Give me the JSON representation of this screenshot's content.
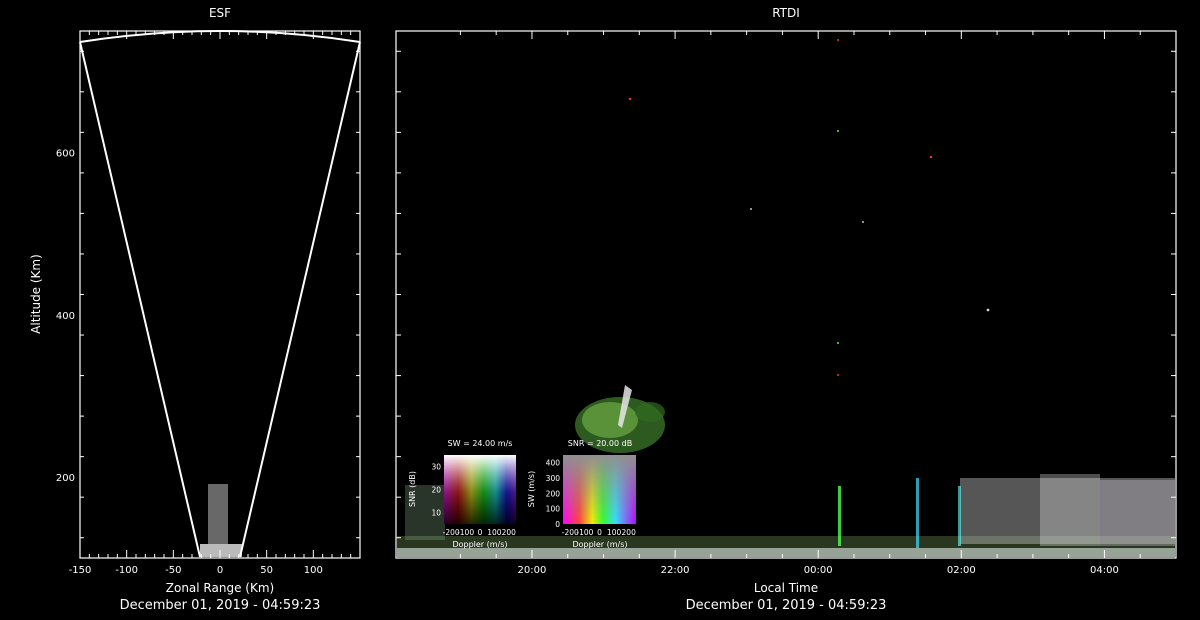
{
  "chart_data": [
    {
      "type": "heatmap",
      "title": "ESF",
      "xlabel": "Zonal Range (Km)",
      "ylabel": "Altitude (Km)",
      "xlim": [
        -150,
        150
      ],
      "ylim": [
        100,
        750
      ],
      "x_ticks": [
        "-150",
        "-100",
        "-50",
        "0",
        "50",
        "100"
      ],
      "x_tick_values": [
        -150,
        -100,
        -50,
        0,
        50,
        100
      ],
      "y_ticks": [
        "200",
        "400",
        "600"
      ],
      "y_tick_values": [
        200,
        400,
        600
      ],
      "grid": false,
      "date": "December 01, 2019 - 04:59:23"
    },
    {
      "type": "heatmap",
      "title": "RTDI",
      "xlabel": "Local Time",
      "ylabel": "",
      "x_ticks": [
        "20:00",
        "22:00",
        "00:00",
        "02:00",
        "04:00"
      ],
      "x_tick_values": [
        20,
        22,
        24,
        26,
        28
      ],
      "xlim": [
        18.1,
        29.0
      ],
      "ylim": [
        100,
        750
      ],
      "grid": false,
      "date": "December 01, 2019 - 04:59:23",
      "legends": [
        {
          "title": "SW = 24.00 m/s",
          "xlabel": "Doppler (m/s)",
          "ylabel": "SNR (dB)",
          "x_ticks": [
            "-200",
            "-100",
            "0",
            "100",
            "200"
          ],
          "y_ticks": [
            "10",
            "20",
            "30"
          ],
          "xlim": [
            -250,
            250
          ],
          "ylim": [
            5,
            35
          ]
        },
        {
          "title": "SNR = 20.00 dB",
          "xlabel": "Doppler (m/s)",
          "ylabel": "SW (m/s)",
          "x_ticks": [
            "-200",
            "-100",
            "0",
            "100",
            "200"
          ],
          "y_ticks": [
            "0",
            "100",
            "200",
            "300",
            "400"
          ],
          "xlim": [
            -250,
            250
          ],
          "ylim": [
            0,
            450
          ]
        }
      ]
    }
  ]
}
